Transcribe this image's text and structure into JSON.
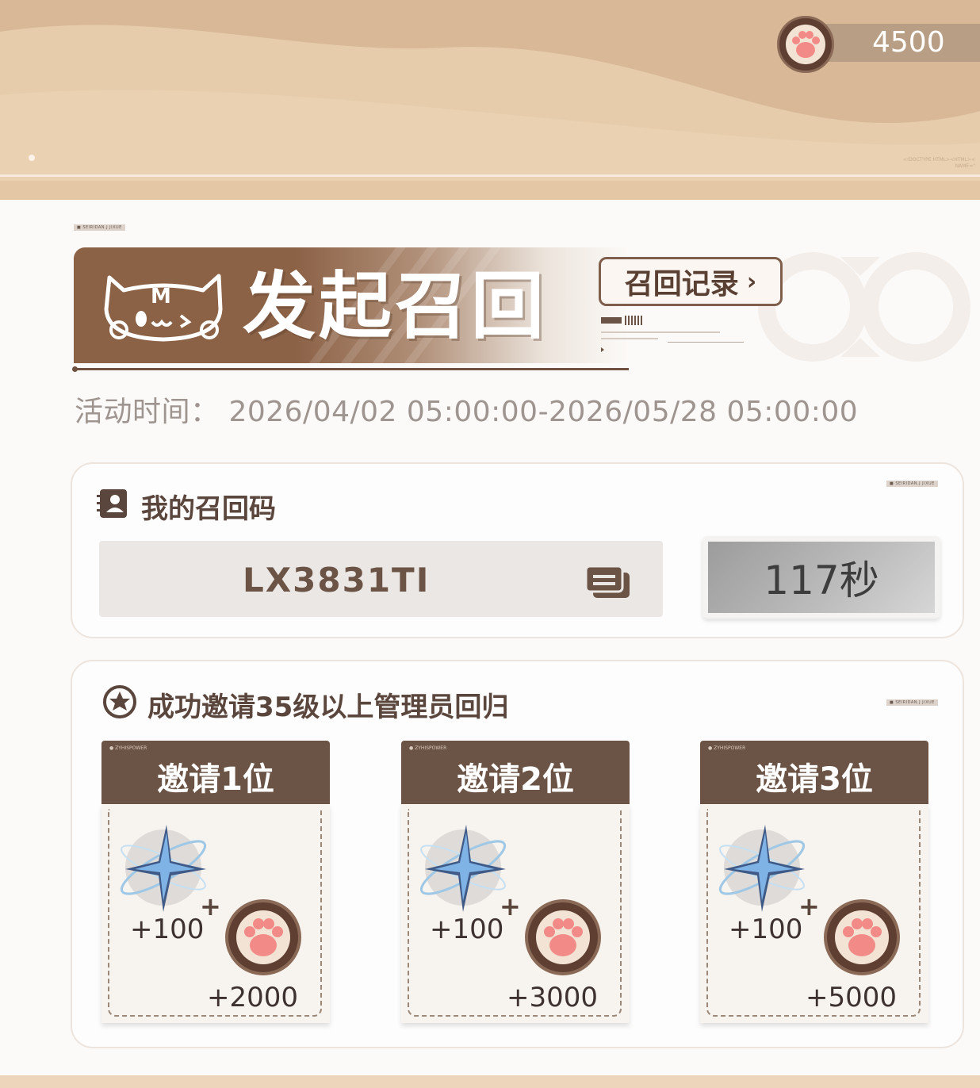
{
  "currency": {
    "value": "4500",
    "icon": "paw-coin-icon"
  },
  "header": {
    "title": "发起召回",
    "logo": "cat-logo-icon",
    "record_button": "召回记录"
  },
  "activity": {
    "label": "活动时间：",
    "range": "2026/04/02 05:00:00-2026/05/28 05:00:00",
    "full": "活动时间： 2026/04/02 05:00:00-2026/05/28 05:00:00"
  },
  "recall_code": {
    "title": "我的召回码",
    "code": "LX3831TI",
    "timer": "117秒"
  },
  "invite": {
    "title": "成功邀请35级以上管理员回归",
    "tiers": [
      {
        "label": "邀请1位",
        "star_qty": "+100",
        "paw_qty": "+2000"
      },
      {
        "label": "邀请2位",
        "star_qty": "+100",
        "paw_qty": "+3000"
      },
      {
        "label": "邀请3位",
        "star_qty": "+100",
        "paw_qty": "+5000"
      }
    ]
  },
  "colors": {
    "accent_brown": "#6b5446",
    "banner_brown": "#8c6247",
    "top_background": "#e6ccab",
    "timer_grey": "#bdbdbd"
  }
}
